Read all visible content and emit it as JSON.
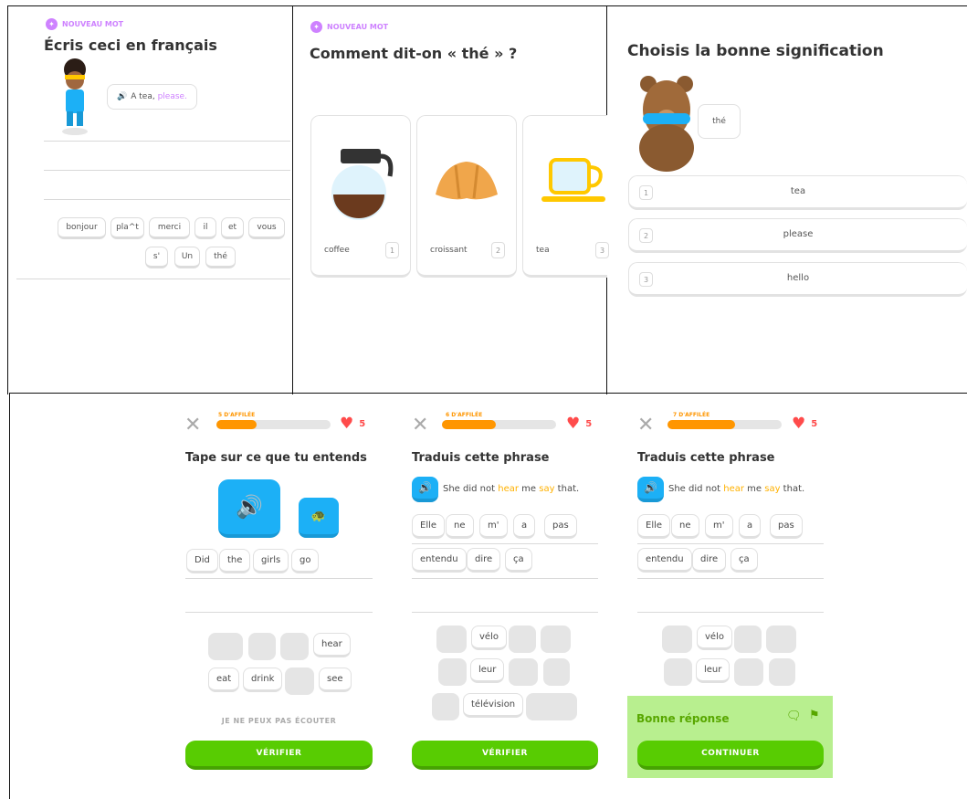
{
  "panel1": {
    "new_word": "NOUVEAU MOT",
    "title": "Écris ceci en français",
    "bubble": {
      "pre": "A tea, ",
      "hl": "please."
    },
    "bank": [
      "bonjour",
      "pla^t",
      "merci",
      "il",
      "et",
      "vous",
      "s'",
      "Un",
      "thé"
    ]
  },
  "panel2": {
    "new_word": "NOUVEAU MOT",
    "title": "Comment dit-on « thé » ?",
    "cards": [
      {
        "label": "coffee",
        "num": "1"
      },
      {
        "label": "croissant",
        "num": "2"
      },
      {
        "label": "tea",
        "num": "3"
      }
    ]
  },
  "panel3": {
    "title": "Choisis la bonne signification",
    "bubble": "thé",
    "options": [
      {
        "num": "1",
        "text": "tea"
      },
      {
        "num": "2",
        "text": "please"
      },
      {
        "num": "3",
        "text": "hello"
      }
    ]
  },
  "s1": {
    "streak": "5 D'AFFILÉE",
    "progress": 0.35,
    "hearts": "5",
    "title": "Tape sur ce que tu entends",
    "answer": [
      "Did",
      "the",
      "girls",
      "go"
    ],
    "bank": [
      "hear",
      "eat",
      "drink",
      "see"
    ],
    "cant_listen": "JE NE PEUX PAS ÉCOUTER",
    "button": "VÉRIFIER"
  },
  "s2": {
    "streak": "6 D'AFFILÉE",
    "progress": 0.47,
    "hearts": "5",
    "title": "Traduis cette phrase",
    "sentence": {
      "a": "She did not ",
      "b": "hear",
      "c": " me ",
      "d": "say",
      "e": " that."
    },
    "answer1": [
      "Elle",
      "ne",
      "m'",
      "a",
      "pas"
    ],
    "answer2": [
      "entendu",
      "dire",
      "ça"
    ],
    "bank": [
      "vélo",
      "leur",
      "télévision"
    ],
    "button": "VÉRIFIER"
  },
  "s3": {
    "streak": "7 D'AFFILÉE",
    "progress": 0.59,
    "hearts": "5",
    "title": "Traduis cette phrase",
    "sentence": {
      "a": "She did not ",
      "b": "hear",
      "c": " me ",
      "d": "say",
      "e": " that."
    },
    "answer1": [
      "Elle",
      "ne",
      "m'",
      "a",
      "pas"
    ],
    "answer2": [
      "entendu",
      "dire",
      "ça"
    ],
    "bank": [
      "vélo",
      "leur"
    ],
    "result": "Bonne réponse",
    "button": "CONTINUER"
  },
  "colors": {
    "green": "#58cc02",
    "blue": "#1cb0f6",
    "orange": "#ff9600",
    "purple": "#ce82ff",
    "red": "#ff4b4b",
    "success_bg": "#b8ef8f"
  }
}
